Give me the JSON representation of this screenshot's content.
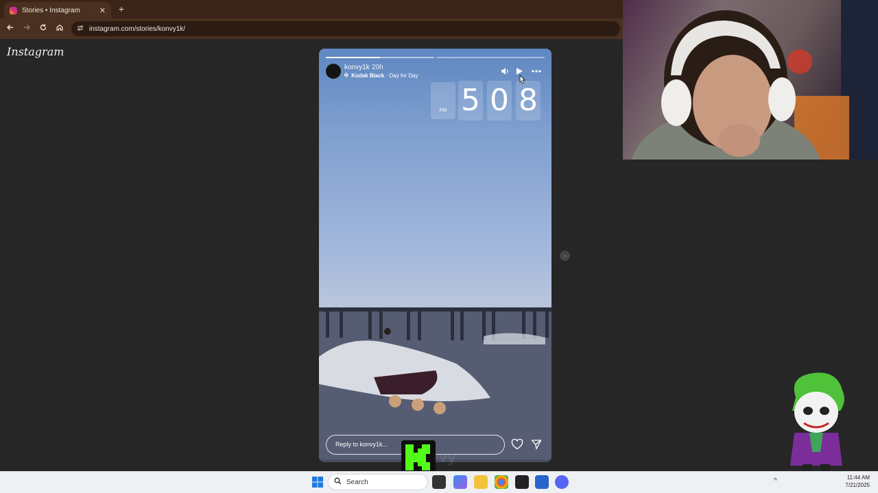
{
  "browser": {
    "tab_title": "Stories • Instagram",
    "tab_close": "✕",
    "new_tab": "+",
    "url": "instagram.com/stories/konvy1k/"
  },
  "page": {
    "logo": "Instagram"
  },
  "story": {
    "username": "konvy1k",
    "time_ago": "20h",
    "song_artist": "Kodak Black",
    "song_sep": " · ",
    "song_title": "Day for Day",
    "progress": [
      0.5,
      0
    ],
    "clock": {
      "ampm": "PM",
      "hour": "5",
      "min_tens": "0",
      "min_ones": "8"
    },
    "reply_placeholder": "Reply to konvy1k...",
    "next_glyph": "›"
  },
  "taskbar": {
    "search_placeholder": "Search",
    "time": "11:44 AM",
    "date": "7/21/2025"
  },
  "overlay": {
    "k_watermark": "vy"
  },
  "icons": [
    "instagram-favicon",
    "back-arrow-icon",
    "forward-arrow-icon",
    "reload-icon",
    "home-icon",
    "site-info-icon",
    "mute-icon",
    "play-icon",
    "more-icon",
    "heart-icon",
    "send-icon",
    "windows-start-icon",
    "search-icon"
  ]
}
